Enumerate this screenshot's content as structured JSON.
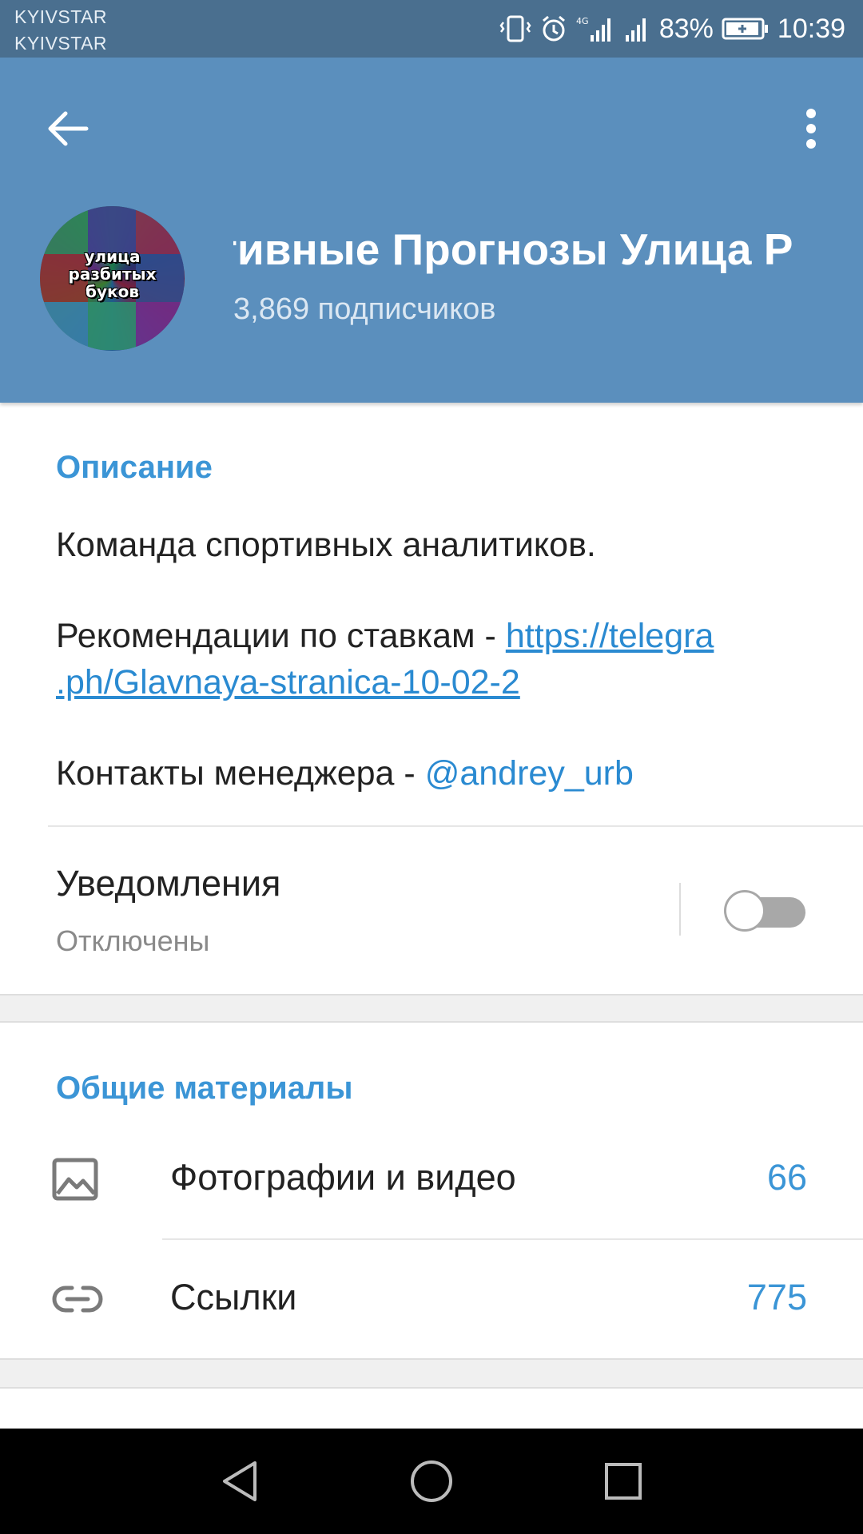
{
  "status_bar": {
    "carrier_1": "KYIVSTAR",
    "carrier_2": "KYIVSTAR",
    "battery_percent": "83%",
    "time": "10:39",
    "network_type": "4G",
    "icons": [
      "vibrate-icon",
      "alarm-icon",
      "signal-icon",
      "signal-icon",
      "battery-icon"
    ]
  },
  "header": {
    "channel_title": "тивные Прогнозы   Улица Р",
    "subscribers": "3,869 подписчиков",
    "avatar_text": "улица разбитых буков",
    "colors": {
      "header_bg": "#5b8fbd",
      "status_bg": "#4a6f8f"
    }
  },
  "description": {
    "section_title": "Описание",
    "line_1": "Команда спортивных аналитиков.",
    "line_2_prefix": "Рекомендации по ставкам - ",
    "line_2_link_part1": "https://telegra",
    "line_2_link_part2": ".ph/Glavnaya-stranica-10-02-2",
    "line_3_prefix": "Контакты менеджера - ",
    "line_3_mention": "@andrey_urb"
  },
  "notifications": {
    "label": "Уведомления",
    "status": "Отключены",
    "enabled": false
  },
  "shared_media": {
    "section_title": "Общие материалы",
    "items": [
      {
        "label": "Фотографии и видео",
        "count": "66",
        "icon": "image-icon"
      },
      {
        "label": "Ссылки",
        "count": "775",
        "icon": "link-icon"
      }
    ]
  },
  "colors": {
    "accent": "#3b95d6",
    "link": "#2a8ad1"
  }
}
